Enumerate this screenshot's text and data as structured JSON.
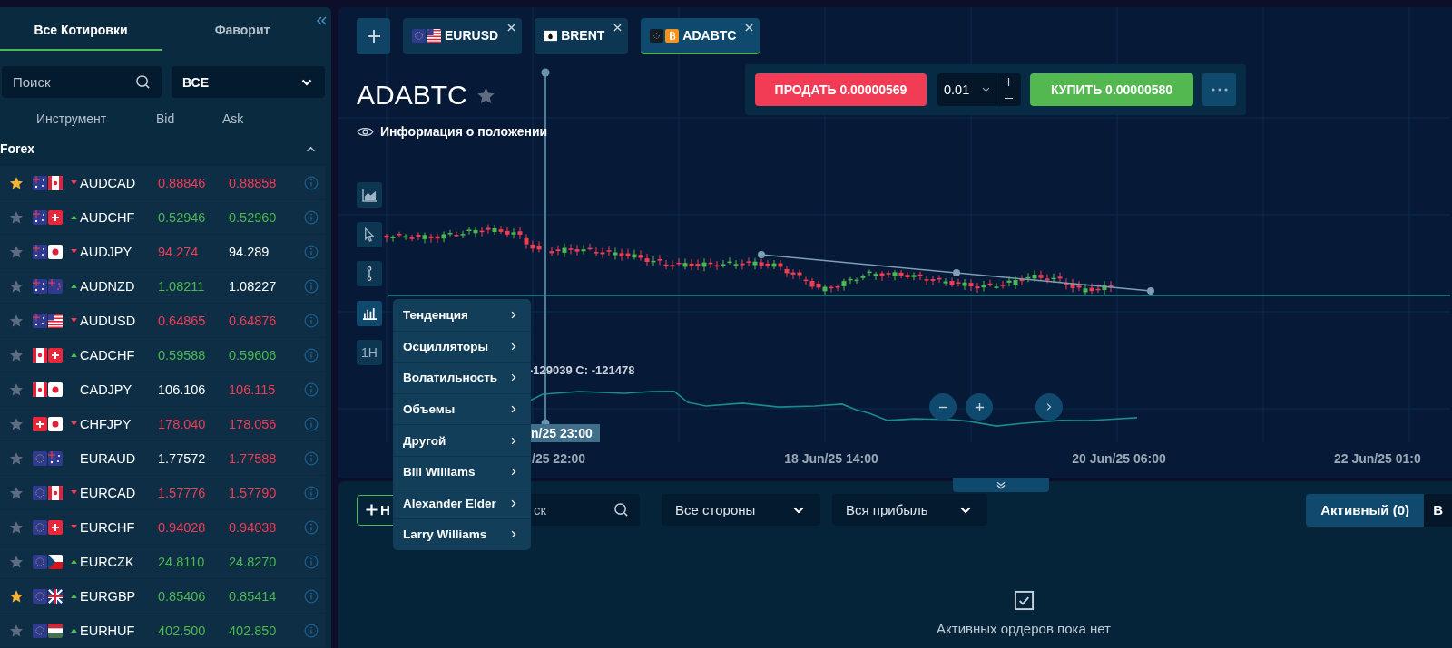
{
  "sidebar": {
    "tabs": [
      {
        "label": "Все Котировки",
        "selected": true
      },
      {
        "label": "Фаворит",
        "selected": false
      }
    ],
    "search": {
      "placeholder": "Поиск"
    },
    "filter": {
      "value": "ВСЕ"
    },
    "columns": [
      "Инструмент",
      "Bid",
      "Ask"
    ],
    "group": {
      "title": "Forex",
      "expanded": true
    },
    "rows": [
      {
        "favorite": true,
        "flags": [
          {
            "kind": "au"
          },
          {
            "kind": "ca"
          }
        ],
        "trend": {
          "rising": false
        },
        "symbol": "AUDCAD",
        "bid": {
          "value": "0.88846",
          "color": "#f23c55"
        },
        "ask": {
          "value": "0.88858",
          "color": "#f23c55"
        }
      },
      {
        "favorite": false,
        "flags": [
          {
            "kind": "au"
          },
          {
            "kind": "ch"
          }
        ],
        "trend": {
          "rising": true
        },
        "symbol": "AUDCHF",
        "bid": {
          "value": "0.52946",
          "color": "#4cb84f"
        },
        "ask": {
          "value": "0.52960",
          "color": "#4cb84f"
        }
      },
      {
        "favorite": false,
        "flags": [
          {
            "kind": "au"
          },
          {
            "kind": "jp"
          }
        ],
        "trend": {
          "rising": false
        },
        "symbol": "AUDJPY",
        "bid": {
          "value": "94.274",
          "color": "#f23c55"
        },
        "ask": {
          "value": "94.289",
          "color": "#ffffff"
        }
      },
      {
        "favorite": false,
        "flags": [
          {
            "kind": "au"
          },
          {
            "kind": "nz"
          }
        ],
        "trend": {
          "rising": true
        },
        "symbol": "AUDNZD",
        "bid": {
          "value": "1.08211",
          "color": "#4cb84f"
        },
        "ask": {
          "value": "1.08227",
          "color": "#ffffff"
        }
      },
      {
        "favorite": false,
        "flags": [
          {
            "kind": "au"
          },
          {
            "kind": "us"
          }
        ],
        "trend": {
          "rising": false
        },
        "symbol": "AUDUSD",
        "bid": {
          "value": "0.64865",
          "color": "#f23c55"
        },
        "ask": {
          "value": "0.64876",
          "color": "#f23c55"
        }
      },
      {
        "favorite": false,
        "flags": [
          {
            "kind": "ca"
          },
          {
            "kind": "ch"
          }
        ],
        "trend": {
          "rising": true
        },
        "symbol": "CADCHF",
        "bid": {
          "value": "0.59588",
          "color": "#4cb84f"
        },
        "ask": {
          "value": "0.59606",
          "color": "#4cb84f"
        }
      },
      {
        "favorite": false,
        "flags": [
          {
            "kind": "ca"
          },
          {
            "kind": "jp"
          }
        ],
        "symbol": "CADJPY",
        "bid": {
          "value": "106.106",
          "color": "#ffffff"
        },
        "ask": {
          "value": "106.115",
          "color": "#f23c55"
        }
      },
      {
        "favorite": false,
        "flags": [
          {
            "kind": "ch"
          },
          {
            "kind": "jp"
          }
        ],
        "trend": {
          "rising": false
        },
        "symbol": "CHFJPY",
        "bid": {
          "value": "178.040",
          "color": "#f23c55"
        },
        "ask": {
          "value": "178.056",
          "color": "#f23c55"
        }
      },
      {
        "favorite": false,
        "flags": [
          {
            "kind": "eu"
          },
          {
            "kind": "au"
          }
        ],
        "symbol": "EURAUD",
        "bid": {
          "value": "1.77572",
          "color": "#ffffff"
        },
        "ask": {
          "value": "1.77588",
          "color": "#f23c55"
        }
      },
      {
        "favorite": false,
        "flags": [
          {
            "kind": "eu"
          },
          {
            "kind": "ca"
          }
        ],
        "trend": {
          "rising": false
        },
        "symbol": "EURCAD",
        "bid": {
          "value": "1.57776",
          "color": "#f23c55"
        },
        "ask": {
          "value": "1.57790",
          "color": "#f23c55"
        }
      },
      {
        "favorite": false,
        "flags": [
          {
            "kind": "eu"
          },
          {
            "kind": "ch"
          }
        ],
        "trend": {
          "rising": false
        },
        "symbol": "EURCHF",
        "bid": {
          "value": "0.94028",
          "color": "#f23c55"
        },
        "ask": {
          "value": "0.94038",
          "color": "#f23c55"
        }
      },
      {
        "favorite": false,
        "flags": [
          {
            "kind": "eu"
          },
          {
            "kind": "cz"
          }
        ],
        "trend": {
          "rising": true
        },
        "symbol": "EURCZK",
        "bid": {
          "value": "24.8110",
          "color": "#4cb84f"
        },
        "ask": {
          "value": "24.8270",
          "color": "#4cb84f"
        }
      },
      {
        "favorite": true,
        "flags": [
          {
            "kind": "eu"
          },
          {
            "kind": "gb"
          }
        ],
        "trend": {
          "rising": true
        },
        "symbol": "EURGBP",
        "bid": {
          "value": "0.85406",
          "color": "#4cb84f"
        },
        "ask": {
          "value": "0.85414",
          "color": "#4cb84f"
        }
      },
      {
        "favorite": false,
        "flags": [
          {
            "kind": "eu"
          },
          {
            "kind": "hu"
          }
        ],
        "trend": {
          "rising": true
        },
        "symbol": "EURHUF",
        "bid": {
          "value": "402.500",
          "color": "#4cb84f"
        },
        "ask": {
          "value": "402.850",
          "color": "#4cb84f"
        }
      }
    ]
  },
  "chart_tabs": [
    {
      "label": "EURUSD",
      "icons": [
        {
          "kind": "eu"
        },
        {
          "kind": "us"
        }
      ],
      "selected": false
    },
    {
      "label": "BRENT",
      "icons": [
        {
          "kind": "oil"
        }
      ],
      "selected": false
    },
    {
      "label": "ADABTC",
      "icons": [
        {
          "kind": "ada"
        },
        {
          "kind": "btc"
        }
      ],
      "selected": true
    }
  ],
  "instrument": {
    "title": "ADABTC",
    "favorite": false,
    "position_info": "Информация о положении"
  },
  "trade": {
    "sell": "ПРОДАТЬ 0.00000569",
    "quantity": "0.01",
    "buy": "КУПИТЬ 0.00000580"
  },
  "tools": [
    {
      "kind": "area",
      "selected": false
    },
    {
      "kind": "cursor",
      "selected": false
    },
    {
      "kind": "measure",
      "selected": false
    },
    {
      "kind": "indicators",
      "selected": true
    },
    {
      "kind": "timeframe",
      "label": "1H",
      "selected": false
    }
  ],
  "chart": {
    "indicator_readout": "-129039 C: -121478",
    "crosshair_time": "n/25 23:00",
    "x_labels": [
      "/25 22:00",
      "18 Jun/25 14:00",
      "20 Jun/25 06:00",
      "22 Jun/25 01:0"
    ]
  },
  "indicator_menu": [
    "Тенденция",
    "Осцилляторы",
    "Волатильность",
    "Объемы",
    "Другой",
    "Bill Williams",
    "Alexander Elder",
    "Larry Williams"
  ],
  "orders": {
    "new_button": "Н",
    "search": {
      "placeholder": "ск"
    },
    "filters": [
      "Все стороны",
      "Вся прибыль"
    ],
    "tabs": [
      {
        "label": "Активный (0)",
        "selected": true
      },
      {
        "label": "В",
        "selected": false
      }
    ],
    "empty_text": "Активных ордеров пока нет"
  }
}
